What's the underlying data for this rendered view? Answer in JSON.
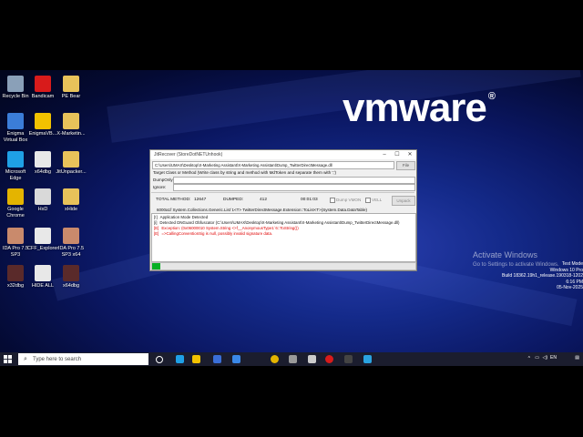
{
  "wallpaper": {
    "brand": "vmware",
    "brand_mark": "®"
  },
  "desktop_icons": [
    {
      "label": "Recycle Bin",
      "icon": "recycle-bin-icon",
      "color": "#8aa0b8"
    },
    {
      "label": "Bandicam",
      "icon": "bandicam-icon",
      "color": "#d81b1b"
    },
    {
      "label": "PE Bear",
      "icon": "folder-icon",
      "color": "#e8c25a"
    },
    {
      "label": "Enigma Virtual Box",
      "icon": "enigma-virtual-box-icon",
      "color": "#3b7dd8"
    },
    {
      "label": "EnigmaVB...",
      "icon": "warning-icon",
      "color": "#f2c200"
    },
    {
      "label": "X-Marketin...",
      "icon": "folder-icon",
      "color": "#e8c25a"
    },
    {
      "label": "Microsoft Edge",
      "icon": "edge-icon",
      "color": "#1fa0e6"
    },
    {
      "label": "x64dbg",
      "icon": "file-icon",
      "color": "#e8e8e8"
    },
    {
      "label": "JitUnpacker...",
      "icon": "folder-icon",
      "color": "#e8c25a"
    },
    {
      "label": "Google Chrome",
      "icon": "chrome-icon",
      "color": "#e4b400"
    },
    {
      "label": "HxD",
      "icon": "hxd-icon",
      "color": "#d9d9d9"
    },
    {
      "label": "xHide",
      "icon": "folder-icon",
      "color": "#e8c25a"
    },
    {
      "label": "IDA Pro 7.5 SP3",
      "icon": "ida-pro-icon",
      "color": "#c98a6c"
    },
    {
      "label": "CFF_Explorer",
      "icon": "cff-explorer-icon",
      "color": "#e8e8e8"
    },
    {
      "label": "IDA Pro 7.5 SP3 x64",
      "icon": "ida-pro-icon",
      "color": "#c98a6c"
    },
    {
      "label": "x32dbg",
      "icon": "bug-icon",
      "color": "#5a2a2a"
    },
    {
      "label": "HIDE ALL",
      "icon": "file-icon",
      "color": "#e8e8e8"
    },
    {
      "label": "x64dbg",
      "icon": "bug-icon",
      "color": "#5a2a2a"
    }
  ],
  "activation": {
    "title": "Activate Windows",
    "subtitle": "Go to Settings to activate Windows."
  },
  "build_info": [
    "Test Mode",
    "Windows 10 Pro",
    "Build 18362.19h1_release.190318-1202",
    "6:16 PM",
    "05-Nov-2025"
  ],
  "taskbar": {
    "search_placeholder": "Type here to search",
    "pinned": [
      "task-view-icon",
      "edge-icon",
      "explorer-icon",
      "store-icon",
      "mail-icon",
      "chrome-icon",
      "vmware-icon",
      "hxd-icon",
      "record-icon",
      "terminal-icon",
      "telegram-icon"
    ],
    "pinned_colors": [
      "#ffffff",
      "#1fa0e6",
      "#f2c200",
      "#3a6fd8",
      "#3a88e8",
      "#e4b400",
      "#9a9a9a",
      "#cccccc",
      "#d81b1b",
      "#444444",
      "#2aa3e0"
    ]
  },
  "window": {
    "title": "JitRecover (StoreDotNETUnhook)",
    "file_path": "C:\\Users\\UMAX\\Desktop\\X-Marketing Assistant\\X-Marketing Assistant\\Dump_TwitterDirectMessage.dll",
    "file_button": "File",
    "target_label": "Target Class or Method (Write class by string and method with MdToken and separate them with ';')",
    "dump_only_label": "DumpOnly:",
    "ignore_label": "Ignore:",
    "total_method_label": "TOTAL METHOD:",
    "total_method_value": "12647",
    "dumped_label": "DUMPED:",
    "dumped_value": "412",
    "timer": "00:01:03",
    "dump_vmon_label": "Dump VMON",
    "vell_label": "VELL",
    "unpack_button": "Unpack",
    "signature": "6000a1f  System.Collections.Generic.List`1<T>  TwitterDirectMessage.Extension::ToList<T>(System.Data.DataTable)",
    "log": [
      {
        "tag": "[!]",
        "text": "Application Mode Detected",
        "color": "#111111"
      },
      {
        "tag": "[i]",
        "text": "Detected DNGuard Obfuscator (C:\\Users\\UMAX\\Desktop\\X-Marketing Assistant\\X-Marketing Assistant\\Dump_TwitterDirectMessage.dll)",
        "color": "#111111"
      },
      {
        "tag": "[E]",
        "text": "Exception: (0x06000010 System.String <>f__AnonymousType1`6::ToString())",
        "color": "#e00000"
      },
      {
        "tag": "[E]",
        "text": "=>CallingConventionSig is null, possibly invalid signature data.",
        "color": "#e00000"
      }
    ],
    "progress": 0.03,
    "progress_color": "#06b025"
  }
}
